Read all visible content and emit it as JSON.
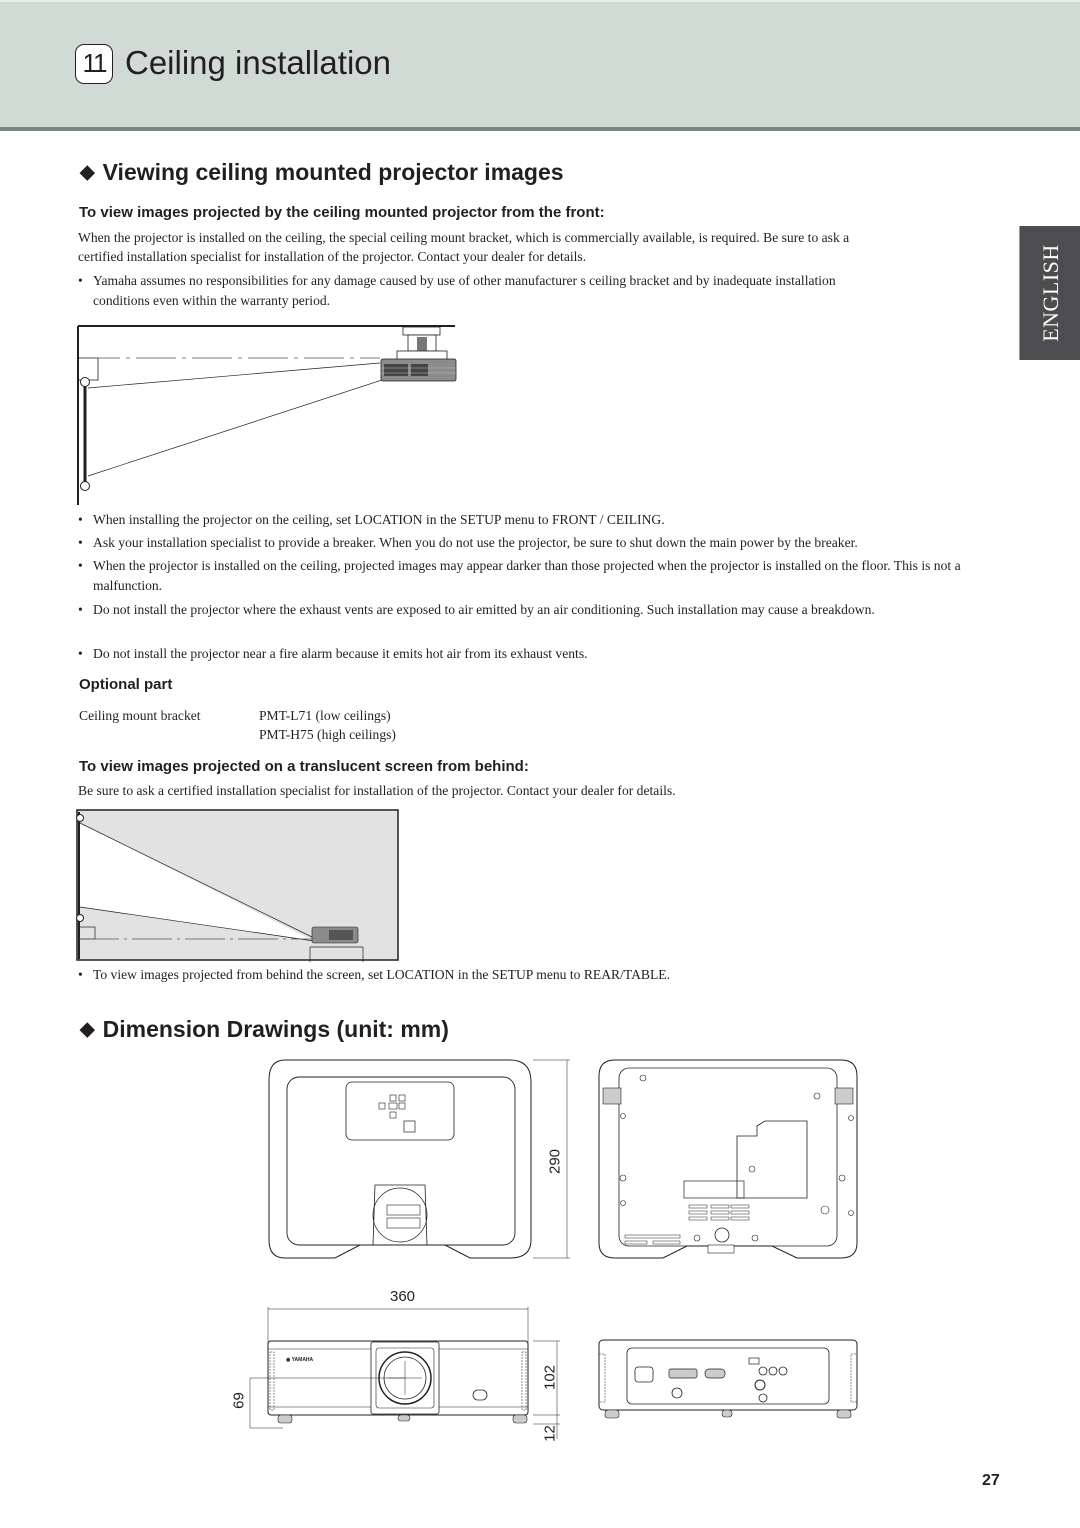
{
  "header": {
    "chapter_number": "11",
    "chapter_title": "Ceiling installation"
  },
  "side_tab": {
    "label": "ENGLISH"
  },
  "section1": {
    "title": "Viewing ceiling mounted projector images",
    "front": {
      "heading": "To view images projected by the ceiling mounted projector from the front:",
      "paragraph_line1": "When the projector is installed on the ceiling, the special ceiling mount bracket, which is commercially available, is required. Be sure to ask a",
      "paragraph_line2": "certified installation specialist for installation of the projector. Contact your dealer for details.",
      "note_line1": "Yamaha assumes no responsibilities for any damage caused by use of other manufacturer s ceiling bracket and by inadequate installation",
      "note_line2": "conditions even within the warranty period."
    },
    "bullets": [
      "When installing the projector on the ceiling, set LOCATION in the SETUP menu to FRONT / CEILING.",
      "Ask your installation specialist to provide a breaker. When you do not use the projector, be sure to shut down the main power by the breaker.",
      "When the projector is installed on the ceiling, projected images may appear darker than those projected when the projector is installed on the floor. This is not a malfunction.",
      "Do not install the projector where the exhaust vents are exposed to air emitted by an air conditioning. Such installation may cause a breakdown.",
      "Do not install the projector near a fire alarm because it emits hot air from its exhaust vents."
    ],
    "optional_part": {
      "heading": "Optional part",
      "label": "Ceiling mount bracket",
      "values": [
        "PMT-L71 (low ceilings)",
        "PMT-H75 (high ceilings)"
      ]
    },
    "rear": {
      "heading": "To view images projected on a translucent screen from behind:",
      "paragraph": "Be sure to ask a certified installation specialist for installation of the projector. Contact your dealer for details.",
      "bullet": "To view images projected from behind the screen, set LOCATION in the SETUP menu to REAR/TABLE."
    }
  },
  "section2": {
    "title": "Dimension Drawings (unit: mm)",
    "dimensions": {
      "depth": "290",
      "width": "360",
      "height": "102",
      "lens_center_height": "69",
      "foot_height": "12"
    }
  },
  "footer": {
    "page_number": "27"
  }
}
